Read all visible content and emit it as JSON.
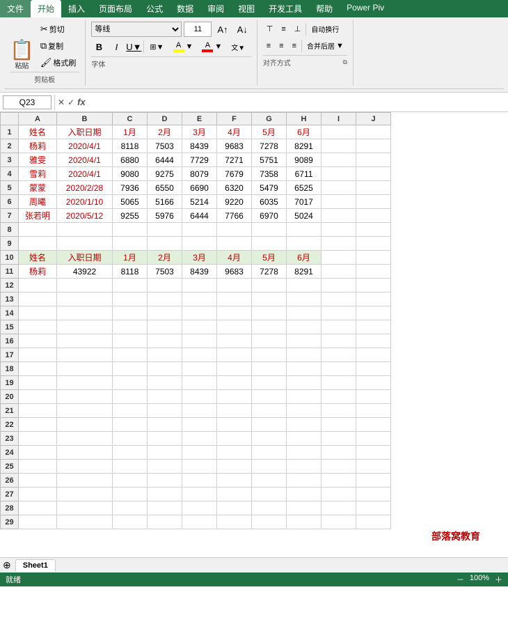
{
  "menu": {
    "items": [
      "文件",
      "开始",
      "插入",
      "页面布局",
      "公式",
      "数据",
      "审阅",
      "视图",
      "开发工具",
      "帮助",
      "Power Piv"
    ],
    "active": "开始"
  },
  "clipboard": {
    "paste_label": "粘贴",
    "cut_label": "剪切",
    "copy_label": "复制",
    "format_label": "格式刷",
    "section_label": "剪贴板"
  },
  "font": {
    "name": "等线",
    "size": "11",
    "section_label": "字体",
    "bold": "B",
    "italic": "I",
    "underline": "U"
  },
  "alignment": {
    "section_label": "对齐方式",
    "wrap_text": "自动换行",
    "merge_label": "合并后居"
  },
  "formula_bar": {
    "cell_ref": "Q23",
    "cancel_icon": "✕",
    "confirm_icon": "✓",
    "fx_icon": "fx"
  },
  "spreadsheet": {
    "col_headers": [
      "",
      "A",
      "B",
      "C",
      "D",
      "E",
      "F",
      "G",
      "H",
      "I",
      "J"
    ],
    "rows": [
      {
        "num": 1,
        "cells": [
          "姓名",
          "入职日期",
          "1月",
          "2月",
          "3月",
          "4月",
          "5月",
          "6月",
          "",
          ""
        ]
      },
      {
        "num": 2,
        "cells": [
          "杨莉",
          "2020/4/1",
          "8118",
          "7503",
          "8439",
          "9683",
          "7278",
          "8291",
          "",
          ""
        ]
      },
      {
        "num": 3,
        "cells": [
          "雅雯",
          "2020/4/1",
          "6880",
          "6444",
          "7729",
          "7271",
          "5751",
          "9089",
          "",
          ""
        ]
      },
      {
        "num": 4,
        "cells": [
          "雪莉",
          "2020/4/1",
          "9080",
          "9275",
          "8079",
          "7679",
          "7358",
          "6711",
          "",
          ""
        ]
      },
      {
        "num": 5,
        "cells": [
          "蒙蒙",
          "2020/2/28",
          "7936",
          "6550",
          "6690",
          "6320",
          "5479",
          "6525",
          "",
          ""
        ]
      },
      {
        "num": 6,
        "cells": [
          "周曦",
          "2020/1/10",
          "5065",
          "5166",
          "5214",
          "9220",
          "6035",
          "7017",
          "",
          ""
        ]
      },
      {
        "num": 7,
        "cells": [
          "张若明",
          "2020/5/12",
          "9255",
          "5976",
          "6444",
          "7766",
          "6970",
          "5024",
          "",
          ""
        ]
      },
      {
        "num": 8,
        "cells": [
          "",
          "",
          "",
          "",
          "",
          "",
          "",
          "",
          "",
          ""
        ]
      },
      {
        "num": 9,
        "cells": [
          "",
          "",
          "",
          "",
          "",
          "",
          "",
          "",
          "",
          ""
        ]
      },
      {
        "num": 10,
        "cells": [
          "姓名",
          "入职日期",
          "1月",
          "2月",
          "3月",
          "4月",
          "5月",
          "6月",
          "",
          ""
        ]
      },
      {
        "num": 11,
        "cells": [
          "杨莉",
          "43922",
          "8118",
          "7503",
          "8439",
          "9683",
          "7278",
          "8291",
          "",
          ""
        ]
      },
      {
        "num": 12,
        "cells": [
          "",
          "",
          "",
          "",
          "",
          "",
          "",
          "",
          "",
          ""
        ]
      },
      {
        "num": 13,
        "cells": [
          "",
          "",
          "",
          "",
          "",
          "",
          "",
          "",
          "",
          ""
        ]
      },
      {
        "num": 14,
        "cells": [
          "",
          "",
          "",
          "",
          "",
          "",
          "",
          "",
          "",
          ""
        ]
      },
      {
        "num": 15,
        "cells": [
          "",
          "",
          "",
          "",
          "",
          "",
          "",
          "",
          "",
          ""
        ]
      },
      {
        "num": 16,
        "cells": [
          "",
          "",
          "",
          "",
          "",
          "",
          "",
          "",
          "",
          ""
        ]
      },
      {
        "num": 17,
        "cells": [
          "",
          "",
          "",
          "",
          "",
          "",
          "",
          "",
          "",
          ""
        ]
      },
      {
        "num": 18,
        "cells": [
          "",
          "",
          "",
          "",
          "",
          "",
          "",
          "",
          "",
          ""
        ]
      },
      {
        "num": 19,
        "cells": [
          "",
          "",
          "",
          "",
          "",
          "",
          "",
          "",
          "",
          ""
        ]
      },
      {
        "num": 20,
        "cells": [
          "",
          "",
          "",
          "",
          "",
          "",
          "",
          "",
          "",
          ""
        ]
      },
      {
        "num": 21,
        "cells": [
          "",
          "",
          "",
          "",
          "",
          "",
          "",
          "",
          "",
          ""
        ]
      },
      {
        "num": 22,
        "cells": [
          "",
          "",
          "",
          "",
          "",
          "",
          "",
          "",
          "",
          ""
        ]
      },
      {
        "num": 23,
        "cells": [
          "",
          "",
          "",
          "",
          "",
          "",
          "",
          "",
          "",
          ""
        ]
      },
      {
        "num": 24,
        "cells": [
          "",
          "",
          "",
          "",
          "",
          "",
          "",
          "",
          "",
          ""
        ]
      },
      {
        "num": 25,
        "cells": [
          "",
          "",
          "",
          "",
          "",
          "",
          "",
          "",
          "",
          ""
        ]
      },
      {
        "num": 26,
        "cells": [
          "",
          "",
          "",
          "",
          "",
          "",
          "",
          "",
          "",
          ""
        ]
      },
      {
        "num": 27,
        "cells": [
          "",
          "",
          "",
          "",
          "",
          "",
          "",
          "",
          "",
          ""
        ]
      },
      {
        "num": 28,
        "cells": [
          "",
          "",
          "",
          "",
          "",
          "",
          "",
          "",
          "",
          ""
        ]
      },
      {
        "num": 29,
        "cells": [
          "",
          "",
          "",
          "",
          "",
          "",
          "",
          "",
          "",
          ""
        ]
      }
    ],
    "watermark": "部落窝教育"
  },
  "sheet_tabs": [
    "Sheet1"
  ],
  "status": {
    "ready": "就绪"
  }
}
